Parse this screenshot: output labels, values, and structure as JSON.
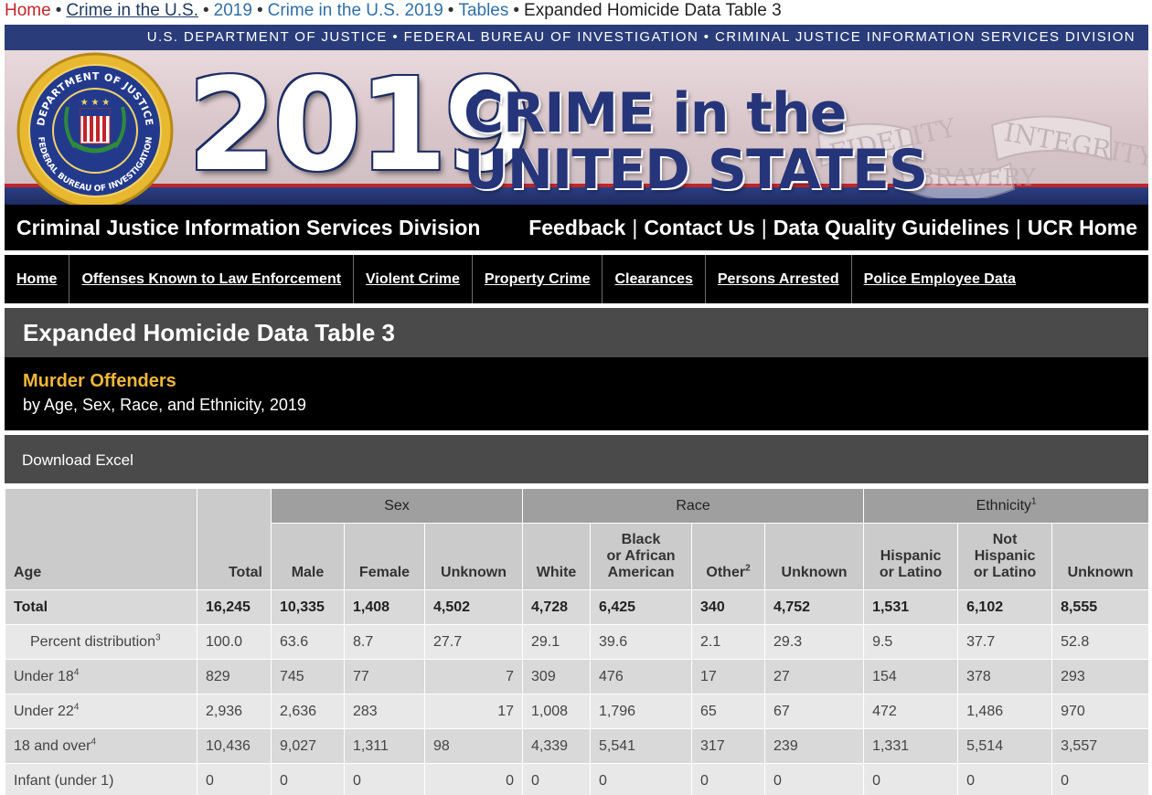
{
  "breadcrumb": {
    "home": "Home",
    "crime_us": "Crime in the U.S.",
    "year": "2019",
    "crime_us_year": "Crime in the U.S. 2019",
    "tables": "Tables",
    "current": "Expanded Homicide Data Table 3",
    "separator": "•"
  },
  "banner": {
    "agency_line": "U.S. DEPARTMENT OF JUSTICE • FEDERAL BUREAU OF INVESTIGATION • CRIMINAL JUSTICE INFORMATION SERVICES DIVISION",
    "year": "2019",
    "title_line1": "CRIME in the",
    "title_line2": "UNITED STATES",
    "seal_top": "DEPARTMENT OF JUSTICE",
    "seal_bottom": "FEDERAL BUREAU OF INVESTIGATION",
    "ribbon_words": [
      "FIDELITY",
      "BRAVERY",
      "INTEGRITY"
    ],
    "colors": {
      "navy": "#2a3d7a",
      "red": "#c0262c",
      "gold": "#e8b830"
    }
  },
  "top_nav": {
    "division": "Criminal Justice Information Services Division",
    "links": [
      "Feedback",
      "Contact Us",
      "Data Quality Guidelines",
      "UCR Home"
    ],
    "separator": "|"
  },
  "menu": {
    "items": [
      "Home",
      "Offenses Known to Law Enforcement",
      "Violent Crime",
      "Property Crime",
      "Clearances",
      "Persons Arrested",
      "Police Employee Data"
    ]
  },
  "page": {
    "title": "Expanded Homicide Data Table 3",
    "subtitle_main": "Murder Offenders",
    "subtitle_sub": "by Age, Sex, Race, and Ethnicity, 2019",
    "download_label": "Download Excel"
  },
  "table": {
    "groups": {
      "sex": "Sex",
      "race": "Race",
      "ethnicity": "Ethnicity",
      "ethnicity_note": "1"
    },
    "columns": {
      "age": "Age",
      "total": "Total",
      "male": "Male",
      "female": "Female",
      "sex_unknown": "Unknown",
      "white": "White",
      "black_l1": "Black",
      "black_l2": "or African",
      "black_l3": "American",
      "other": "Other",
      "other_note": "2",
      "race_unknown": "Unknown",
      "hispanic_l1": "Hispanic",
      "hispanic_l2": "or Latino",
      "not_hispanic_l1": "Not",
      "not_hispanic_l2": "Hispanic",
      "not_hispanic_l3": "or Latino",
      "eth_unknown": "Unknown"
    },
    "rows": [
      {
        "label": "Total",
        "note": "",
        "values": [
          "16,245",
          "10,335",
          "1,408",
          "4,502",
          "4,728",
          "6,425",
          "340",
          "4,752",
          "1,531",
          "6,102",
          "8,555"
        ]
      },
      {
        "label": "Percent distribution",
        "note": "3",
        "values": [
          "100.0",
          "63.6",
          "8.7",
          "27.7",
          "29.1",
          "39.6",
          "2.1",
          "29.3",
          "9.5",
          "37.7",
          "52.8"
        ]
      },
      {
        "label": "Under 18",
        "note": "4",
        "values": [
          "829",
          "745",
          "77",
          "7",
          "309",
          "476",
          "17",
          "27",
          "154",
          "378",
          "293"
        ]
      },
      {
        "label": "Under 22",
        "note": "4",
        "values": [
          "2,936",
          "2,636",
          "283",
          "17",
          "1,008",
          "1,796",
          "65",
          "67",
          "472",
          "1,486",
          "970"
        ]
      },
      {
        "label": "18 and over",
        "note": "4",
        "values": [
          "10,436",
          "9,027",
          "1,311",
          "98",
          "4,339",
          "5,541",
          "317",
          "239",
          "1,331",
          "5,514",
          "3,557"
        ]
      },
      {
        "label": "Infant (under 1)",
        "note": "",
        "values": [
          "0",
          "0",
          "0",
          "0",
          "0",
          "0",
          "0",
          "0",
          "0",
          "0",
          "0"
        ]
      }
    ]
  }
}
